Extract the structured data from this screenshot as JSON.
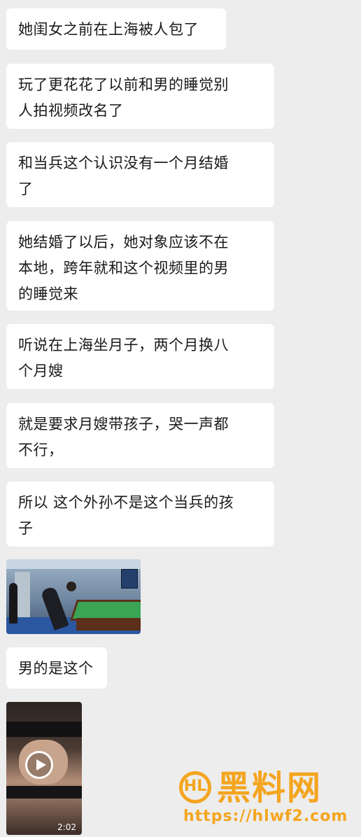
{
  "messages": [
    {
      "lines": [
        "她闺女之前在上海被人包了"
      ]
    },
    {
      "lines": [
        "玩了更花花了以前和男的睡觉别",
        "人拍视频改名了"
      ]
    },
    {
      "lines": [
        "和当兵这个认识没有一个月结婚",
        "了"
      ]
    },
    {
      "lines": [
        "她结婚了以后，她对象应该不在",
        "本地，跨年就和这个视频里的男",
        "的睡觉来"
      ]
    },
    {
      "lines": [
        "听说在上海坐月子，两个月换八",
        "个月嫂"
      ]
    },
    {
      "lines": [
        "就是要求月嫂带孩子，哭一声都",
        "不行，"
      ]
    },
    {
      "lines": [
        "所以 这个外孙不是这个当兵的孩",
        "子"
      ]
    },
    {
      "lines": [
        "男的是这个"
      ]
    }
  ],
  "media": {
    "photo_icon": "billiards-photo",
    "video_icon": "play-icon",
    "video_duration": "2:02"
  },
  "watermark": {
    "logo_text": "HL",
    "title": "黑料网",
    "url": "https://hlwf2.com",
    "color": "#f4a51f"
  },
  "colors": {
    "background": "#ededed",
    "bubble": "#ffffff",
    "text": "#1a1a1a"
  }
}
